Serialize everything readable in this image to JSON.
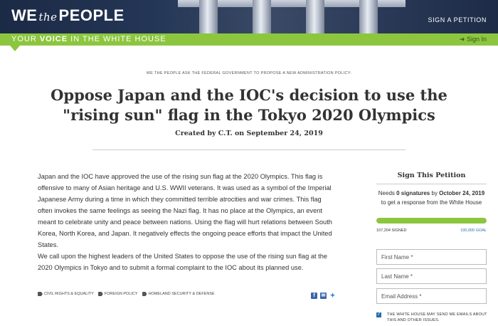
{
  "header": {
    "logo_we": "WE",
    "logo_the": "the",
    "logo_people": "PEOPLE",
    "sign_petition": "SIGN A PETITION"
  },
  "greenbar": {
    "tagline_pre": "YOUR ",
    "tagline_bold": "VOICE",
    "tagline_post": " IN THE WHITE HOUSE",
    "signin": "Sign In"
  },
  "petition": {
    "ask": "WE THE PEOPLE ASK THE FEDERAL GOVERNMENT TO PROPOSE A NEW ADMINISTRATION POLICY:",
    "title": "Oppose Japan and the IOC's decision to use the \"rising sun\" flag in the Tokyo 2020 Olympics",
    "created": "Created by C.T. on September 24, 2019",
    "body_p1": "Japan and the IOC have approved the use of the rising sun flag at the 2020 Olympics. This flag is offensive to many of Asian heritage and U.S. WWII veterans. It was used as a symbol of the Imperial Japanese Army during a time in which they committed terrible atrocities and war crimes. This flag often invokes the same feelings as seeing the Nazi flag. It has no place at the Olympics, an event meant to celebrate unity and peace between nations. Using the flag will hurt relations between South Korea, North Korea, and Japan. It negatively effects the ongoing peace efforts that impact the United States.",
    "body_p2": "We call upon the highest leaders of the United States to oppose the use of the rising sun flag at the 2020 Olympics in Tokyo and to submit a formal complaint to the IOC about its planned use.",
    "issues": [
      "CIVIL RIGHTS & EQUALITY",
      "FOREIGN POLICY",
      "HOMELAND SECURITY & DEFENSE"
    ]
  },
  "sidebar": {
    "title": "Sign This Petition",
    "needs_pre": "Needs ",
    "needs_bold": "0 signatures",
    "needs_mid": " by ",
    "needs_date": "October 24, 2019",
    "needs_post": "to get a response from the White House",
    "signed": "107,204 SIGNED",
    "goal": "100,000 GOAL",
    "progress_fraction": 1.0,
    "first_name": "First Name *",
    "last_name": "Last Name *",
    "email": "Email Address *",
    "consent": "THE WHITE HOUSE MAY SEND ME EMAILS ABOUT THIS AND OTHER ISSUES."
  },
  "colors": {
    "accent_green": "#8cc63f",
    "link_blue": "#2a6cb0",
    "header_navy": "#1b2a45"
  }
}
